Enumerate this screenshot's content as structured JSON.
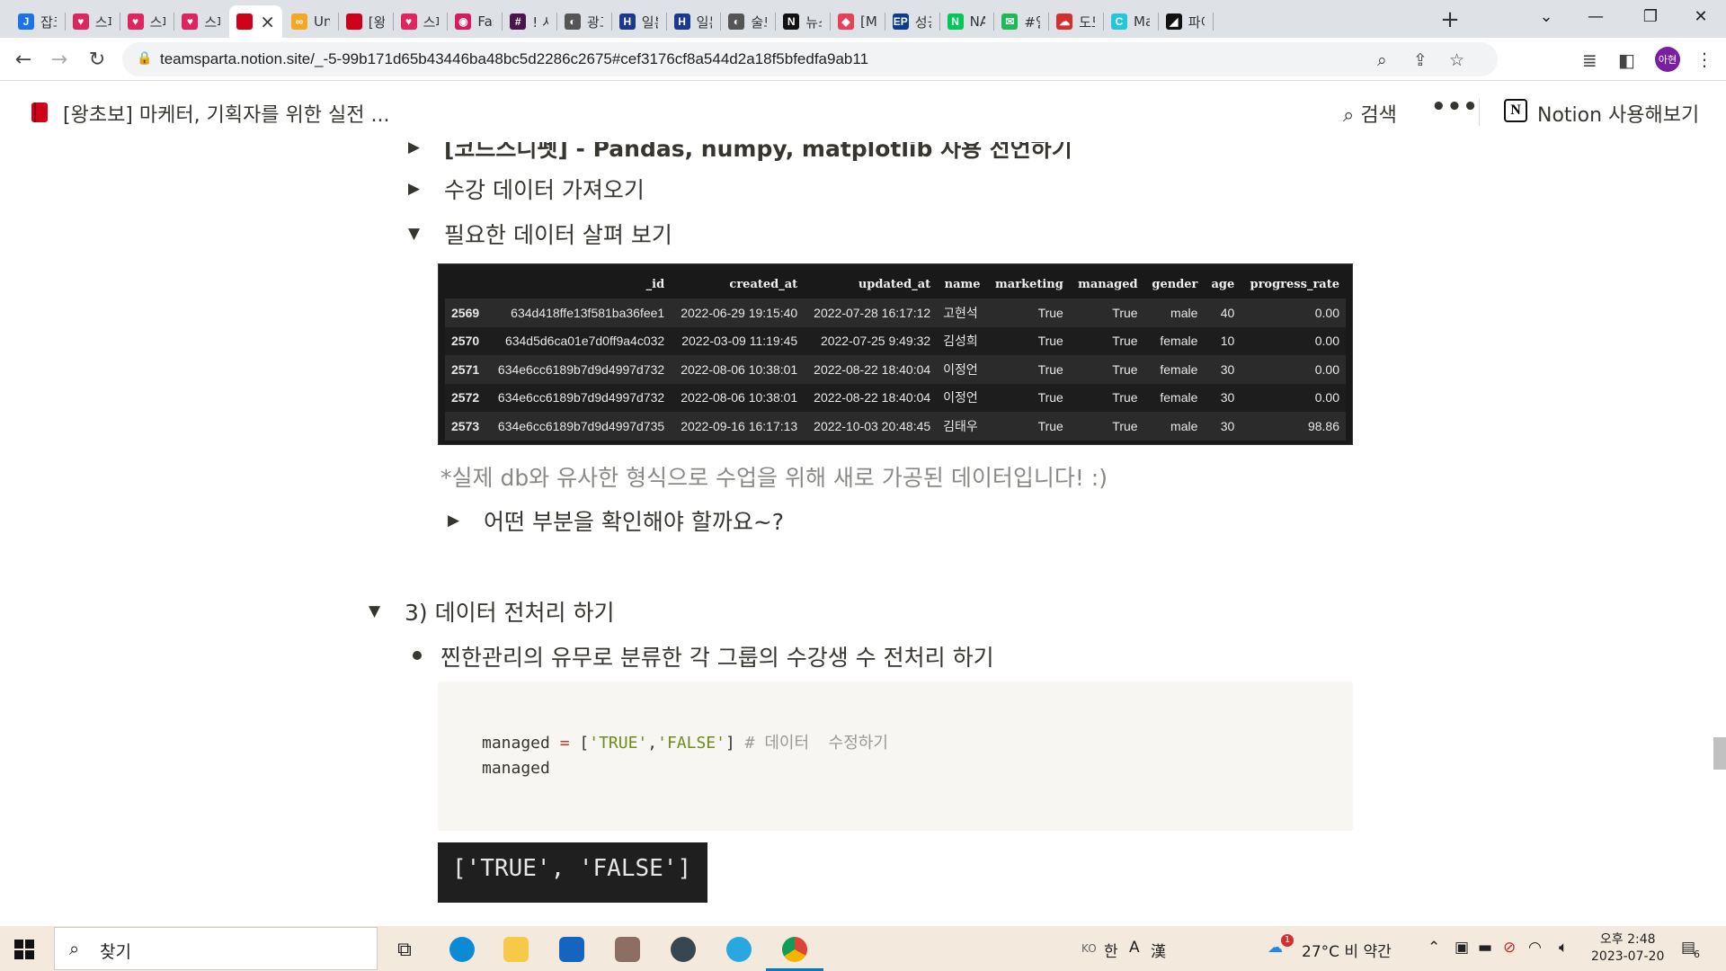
{
  "browser": {
    "tabs": [
      {
        "title": "잡코",
        "icon": "J",
        "color": "#1a73e8"
      },
      {
        "title": "스파",
        "icon": "♥",
        "color": "#e0245e"
      },
      {
        "title": "스파",
        "icon": "♥",
        "color": "#e0245e"
      },
      {
        "title": "스파",
        "icon": "♥",
        "color": "#e0245e"
      },
      {
        "title": "",
        "icon": "",
        "color": "#d0021b"
      },
      {
        "title": "Un",
        "icon": "∞",
        "color": "#f5a623"
      },
      {
        "title": "[왕",
        "icon": "",
        "color": "#d0021b"
      },
      {
        "title": "스파",
        "icon": "♥",
        "color": "#e0245e"
      },
      {
        "title": "Fas",
        "icon": "◉",
        "color": "#d81b60"
      },
      {
        "title": "! 시",
        "icon": "#",
        "color": "#4a154b"
      },
      {
        "title": "광고",
        "icon": "◐",
        "color": "#555555"
      },
      {
        "title": "일본",
        "icon": "H",
        "color": "#1b3a8f"
      },
      {
        "title": "일본",
        "icon": "H",
        "color": "#1b3a8f"
      },
      {
        "title": "술드",
        "icon": "◐",
        "color": "#555555"
      },
      {
        "title": "뉴스",
        "icon": "N",
        "color": "#111111"
      },
      {
        "title": "[M",
        "icon": "◆",
        "color": "#e94057"
      },
      {
        "title": "성공",
        "icon": "EP",
        "color": "#0a3d91"
      },
      {
        "title": "NA",
        "icon": "N",
        "color": "#03c75a"
      },
      {
        "title": "#일",
        "icon": "✉",
        "color": "#1db954"
      },
      {
        "title": "도도",
        "icon": "☁",
        "color": "#d32f2f"
      },
      {
        "title": "Ma",
        "icon": "C",
        "color": "#26c6da"
      },
      {
        "title": "파이",
        "icon": "◢",
        "color": "#111111"
      }
    ],
    "new_tab_label": "+",
    "url": "teamsparta.notion.site/_-5-99b171d65b43446ba48bc5d2286c2675#cef3176cf8a544d2a18f5bfedfa9ab11",
    "profile_label": "아현"
  },
  "notion": {
    "page_title": "[왕초보] 마케터, 기획자를 위한 실전 ...",
    "search_label": "검색",
    "try_notion_label": "Notion 사용해보기"
  },
  "content": {
    "toggle_cut": "[코드스니펫] - Pandas, numpy, matplotlib 사용 선언하기",
    "toggle_import": "수강 데이터 가져오기",
    "toggle_inspect": "필요한 데이터 살펴 보기",
    "note": "*실제 db와 유사한 형식으로 수업을 위해 새로 가공된 데이터입니다! :)",
    "toggle_check": "어떤 부분을 확인해야 할까요~?",
    "section_heading": "3) 데이터 전처리 하기",
    "bullet_text": "찐한관리의 유무로 분류한 각 그룹의 수강생 수 전처리 하기",
    "dataframe": {
      "columns": [
        "",
        "_id",
        "created_at",
        "updated_at",
        "name",
        "marketing",
        "managed",
        "gender",
        "age",
        "progress_rate"
      ],
      "rows": [
        [
          "2569",
          "634d418ffe13f581ba36fee1",
          "2022-06-29 19:15:40",
          "2022-07-28 16:17:12",
          "고현석",
          "True",
          "True",
          "male",
          "40",
          "0.00"
        ],
        [
          "2570",
          "634d5d6ca01e7d0ff9a4c032",
          "2022-03-09 11:19:45",
          "2022-07-25 9:49:32",
          "김성희",
          "True",
          "True",
          "female",
          "10",
          "0.00"
        ],
        [
          "2571",
          "634e6cc6189b7d9d4997d732",
          "2022-08-06 10:38:01",
          "2022-08-22 18:40:04",
          "이정언",
          "True",
          "True",
          "female",
          "30",
          "0.00"
        ],
        [
          "2572",
          "634e6cc6189b7d9d4997d732",
          "2022-08-06 10:38:01",
          "2022-08-22 18:40:04",
          "이정언",
          "True",
          "True",
          "female",
          "30",
          "0.00"
        ],
        [
          "2573",
          "634e6cc6189b7d9d4997d735",
          "2022-09-16 16:17:13",
          "2022-10-03 20:48:45",
          "김태우",
          "True",
          "True",
          "male",
          "30",
          "98.86"
        ]
      ]
    },
    "code": {
      "var": "managed",
      "op": "=",
      "open_bracket": "[",
      "str1": "'TRUE'",
      "comma": ",",
      "str2": "'FALSE'",
      "close_bracket": "]",
      "comment": "# 데이터  수정하기",
      "line2": "managed"
    },
    "output": "['TRUE', 'FALSE']"
  },
  "taskbar": {
    "search_placeholder": "찾기",
    "ime_ko": "KO",
    "ime_han": "한",
    "ime_a": "A",
    "ime_hanja": "漢",
    "weather": "27°C  비 약간",
    "weather_badge": "1",
    "time": "오후 2:48",
    "date": "2023-07-20",
    "notification_count": "6"
  },
  "colors": {
    "tab_strip": "#dee1e6",
    "notion_text": "#37352f",
    "dataframe_bg": "#191919",
    "taskbar": "#f3e9dc",
    "accent": "#0078d4"
  }
}
